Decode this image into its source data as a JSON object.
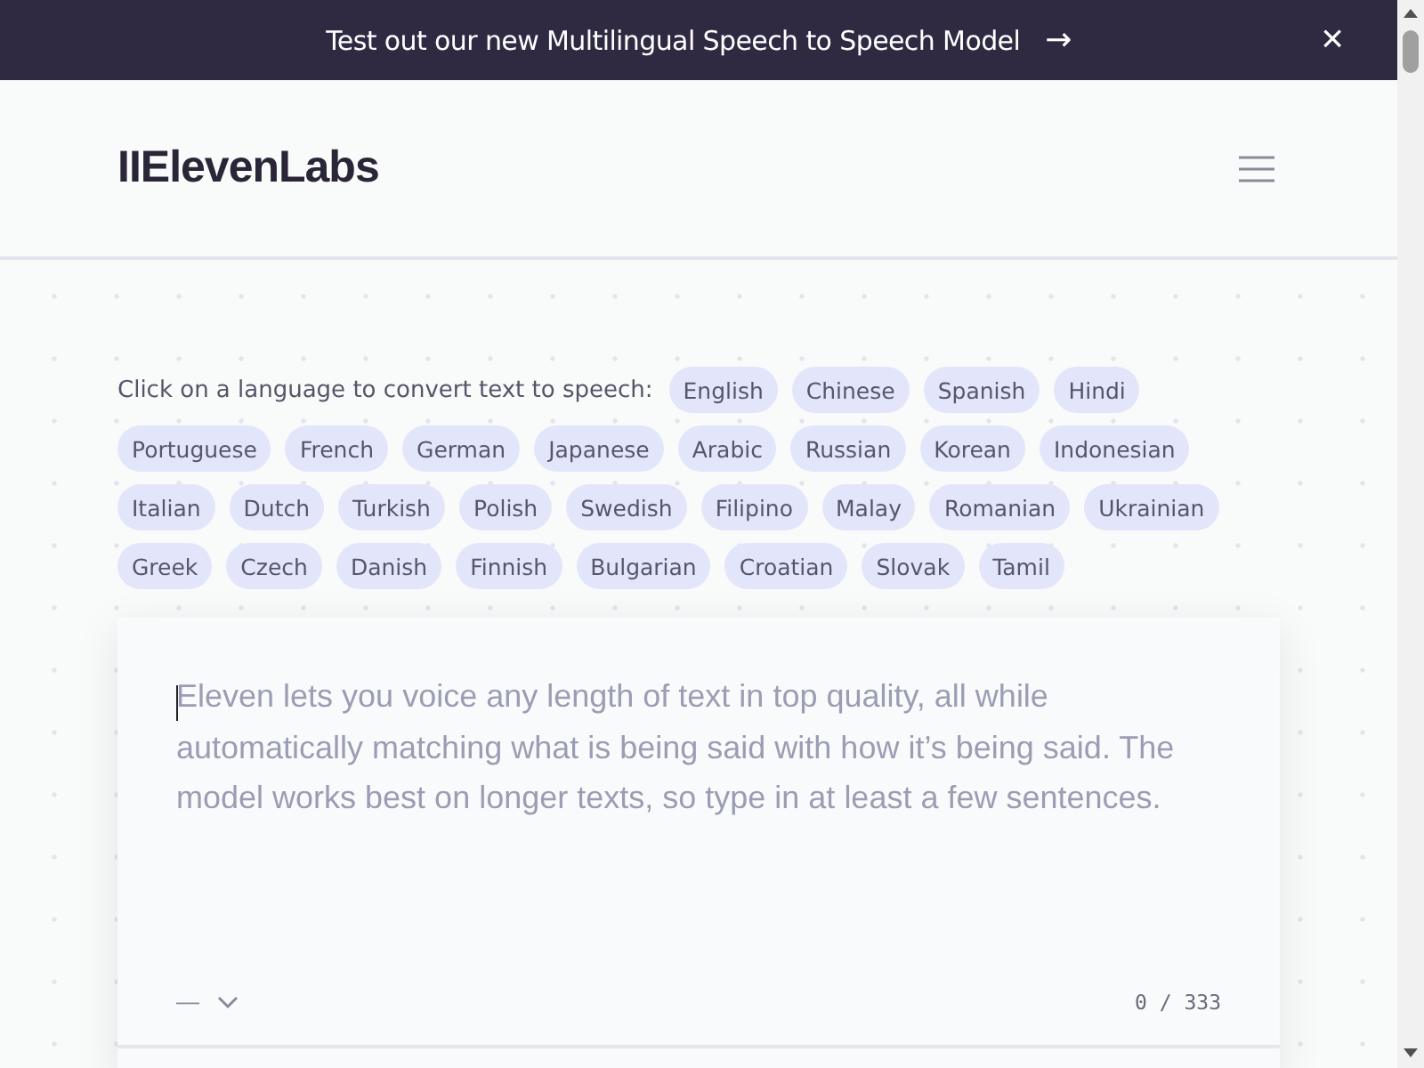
{
  "banner": {
    "text": "Test out our new Multilingual Speech to Speech Model",
    "arrow": "→",
    "close": "×"
  },
  "header": {
    "logo": "IIElevenLabs"
  },
  "languages": {
    "label": "Click on a language to convert text to speech:",
    "items": [
      {
        "label": "English"
      },
      {
        "label": "Chinese"
      },
      {
        "label": "Spanish"
      },
      {
        "label": "Hindi"
      },
      {
        "label": "Portuguese"
      },
      {
        "label": "French"
      },
      {
        "label": "German"
      },
      {
        "label": "Japanese"
      },
      {
        "label": "Arabic"
      },
      {
        "label": "Russian"
      },
      {
        "label": "Korean"
      },
      {
        "label": "Indonesian"
      },
      {
        "label": "Italian"
      },
      {
        "label": "Dutch"
      },
      {
        "label": "Turkish"
      },
      {
        "label": "Polish"
      },
      {
        "label": "Swedish"
      },
      {
        "label": "Filipino"
      },
      {
        "label": "Malay"
      },
      {
        "label": "Romanian"
      },
      {
        "label": "Ukrainian"
      },
      {
        "label": "Greek"
      },
      {
        "label": "Czech"
      },
      {
        "label": "Danish"
      },
      {
        "label": "Finnish"
      },
      {
        "label": "Bulgarian"
      },
      {
        "label": "Croatian"
      },
      {
        "label": "Slovak"
      },
      {
        "label": "Tamil"
      }
    ]
  },
  "editor": {
    "placeholder": "Eleven lets you voice any length of text in top quality, all while automatically matching what is being said with how it’s being said. The model works best on longer texts, so type in at least a few sentences.",
    "voice": "—",
    "counter": "0 / 333"
  }
}
